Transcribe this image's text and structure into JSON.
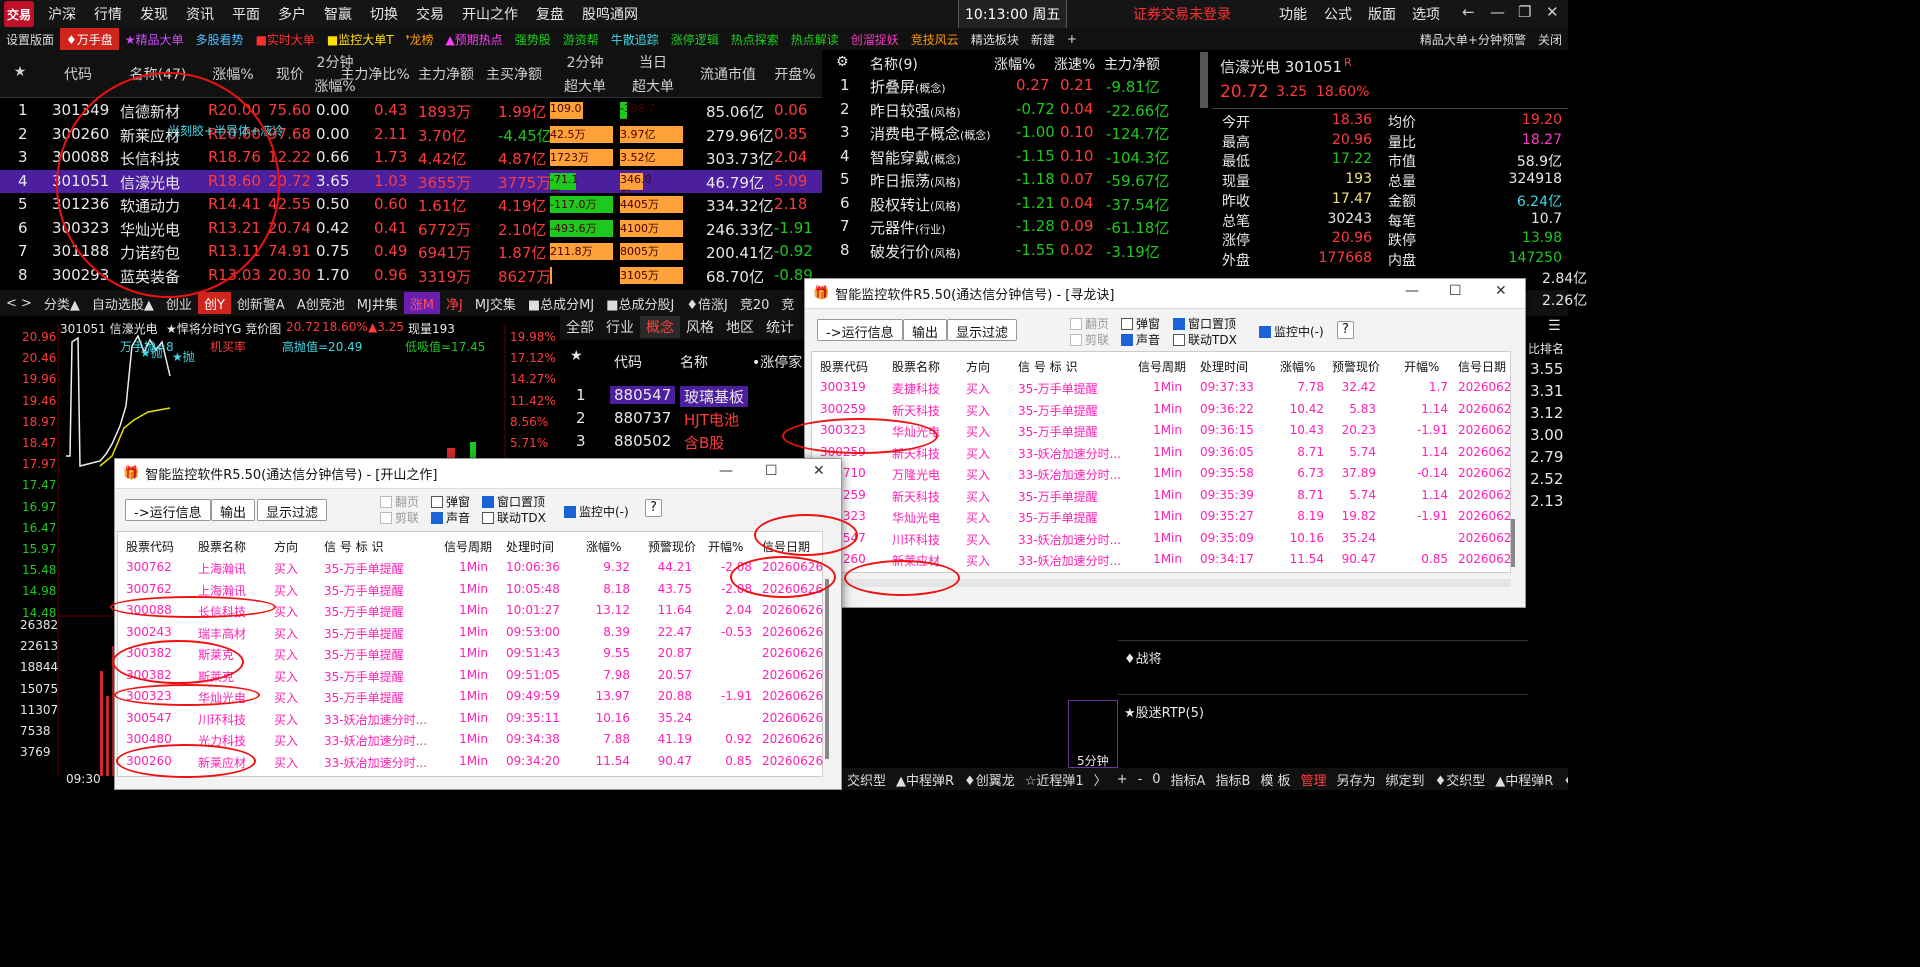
{
  "menu": {
    "logo": "交易",
    "items": [
      "沪深",
      "行情",
      "发现",
      "资讯",
      "平面",
      "多户",
      "智赢",
      "切换",
      "交易",
      "开山之作",
      "复盘",
      "股鸣通网"
    ],
    "time": "10:13:00 周五",
    "warning": "证券交易未登录",
    "right": [
      "功能",
      "公式",
      "版面",
      "选项"
    ],
    "controls": [
      "←",
      "—",
      "❐",
      "✕"
    ]
  },
  "tabs": [
    "设置版面",
    "♦万手盘",
    "★精品大单",
    "多股看势",
    "■实时大单",
    "■监控大单T",
    "❜龙榜",
    "▲预期热点",
    "强势股",
    "游资帮",
    "牛散追踪",
    "涨停逻辑",
    "热点探索",
    "热点解读",
    "创溜捉妖",
    "竞技风云",
    "精选板块",
    "新建",
    "+",
    "精品大单+分钟预警",
    "关闭"
  ],
  "lhead": {
    "star": "★",
    "code": "代码",
    "name": "名称(47)",
    "pct": "涨幅%",
    "price": "现价",
    "min2a": "2分钟",
    "min2b": "涨幅%",
    "zl": "主力净比%",
    "zlj": "主力净额",
    "zm": "主买净额",
    "mm2a": "2分钟",
    "mm2b": "超大单",
    "daya": "当日",
    "dayb": "超大单",
    "mv": "流通市值",
    "open": "开盘%"
  },
  "lrows": [
    {
      "n": "1",
      "code": "301349",
      "name": "信德新材",
      "pct": "20.00",
      "price": "75.60",
      "m2": "0.00",
      "zl": "0.43",
      "zlj": "1893万",
      "zm": "1.99亿",
      "b1": "109.0万",
      "b1v": 0.5,
      "b1c": "o",
      "b2": "-398.7万",
      "b2v": 0.1,
      "b2c": "g",
      "mv": "85.06亿",
      "open": "0.06"
    },
    {
      "n": "2",
      "code": "300260",
      "name": "新莱应材",
      "pct": "20.00",
      "price": "97.68",
      "m2": "0.00",
      "zl": "2.11",
      "zlj": "3.70亿",
      "zm": "-4.45亿",
      "b1": "42.5万",
      "b1v": 0.95,
      "b1c": "o",
      "b2": "3.97亿",
      "b2v": 0.95,
      "b2c": "o",
      "mv": "279.96亿",
      "open": "0.85"
    },
    {
      "n": "3",
      "code": "300088",
      "name": "长信科技",
      "pct": "18.76",
      "price": "12.22",
      "m2": "0.66",
      "zl": "1.73",
      "zlj": "4.42亿",
      "zm": "4.87亿",
      "b1": "1723万",
      "b1v": 0.95,
      "b1c": "o",
      "b2": "3.52亿",
      "b2v": 0.95,
      "b2c": "o",
      "mv": "303.73亿",
      "open": "2.04"
    },
    {
      "n": "4",
      "code": "301051",
      "name": "信濠光电",
      "pct": "18.60",
      "price": "20.72",
      "m2": "3.65",
      "zl": "1.03",
      "zlj": "3655万",
      "zm": "3775万",
      "b1": "-71.1万",
      "b1v": 0.4,
      "b1c": "g",
      "b2": "346.0万",
      "b2v": 0.35,
      "b2c": "o",
      "mv": "46.79亿",
      "open": "5.09"
    },
    {
      "n": "5",
      "code": "301236",
      "name": "软通动力",
      "pct": "14.41",
      "price": "42.55",
      "m2": "0.50",
      "zl": "0.60",
      "zlj": "1.61亿",
      "zm": "4.19亿",
      "b1": "-117.0万",
      "b1v": 0.95,
      "b1c": "g",
      "b2": "4405万",
      "b2v": 0.95,
      "b2c": "o",
      "mv": "334.32亿",
      "open": "2.18"
    },
    {
      "n": "6",
      "code": "300323",
      "name": "华灿光电",
      "pct": "13.21",
      "price": "20.74",
      "m2": "0.42",
      "zl": "0.41",
      "zlj": "6772万",
      "zm": "2.10亿",
      "b1": "-493.6万",
      "b1v": 0.95,
      "b1c": "g",
      "b2": "4100万",
      "b2v": 0.95,
      "b2c": "o",
      "mv": "246.33亿",
      "open": "-1.91"
    },
    {
      "n": "7",
      "code": "301188",
      "name": "力诺药包",
      "pct": "13.11",
      "price": "74.91",
      "m2": "0.75",
      "zl": "0.49",
      "zlj": "6941万",
      "zm": "1.87亿",
      "b1": "211.8万",
      "b1v": 0.95,
      "b1c": "o",
      "b2": "8005万",
      "b2v": 0.95,
      "b2c": "o",
      "mv": "200.41亿",
      "open": "-0.92"
    },
    {
      "n": "8",
      "code": "300293",
      "name": "蓝英装备",
      "pct": "13.03",
      "price": "20.30",
      "m2": "1.70",
      "zl": "0.96",
      "zlj": "3319万",
      "zm": "8627万",
      "b1": "",
      "b1v": 0.03,
      "b1c": "o",
      "b2": "3105万",
      "b2v": 0.95,
      "b2c": "o",
      "mv": "68.70亿",
      "open": "-0.89"
    }
  ],
  "overlay_text": "光刻胶+半导体+液冷",
  "rpanel": {
    "head": [
      "名称(9)",
      "涨幅%",
      "涨速%",
      "主力净额"
    ],
    "rows": [
      {
        "n": "1",
        "name": "折叠屏",
        "tag": "(概念)",
        "pct": "0.27",
        "spd": "0.21",
        "amt": "-9.81亿"
      },
      {
        "n": "2",
        "name": "昨日较强",
        "tag": "(风格)",
        "pct": "-0.72",
        "spd": "0.04",
        "amt": "-22.66亿"
      },
      {
        "n": "3",
        "name": "消费电子概念",
        "tag": "(概念)",
        "pct": "-1.00",
        "spd": "0.10",
        "amt": "-124.7亿"
      },
      {
        "n": "4",
        "name": "智能穿戴",
        "tag": "(概念)",
        "pct": "-1.15",
        "spd": "0.10",
        "amt": "-104.3亿"
      },
      {
        "n": "5",
        "name": "昨日振荡",
        "tag": "(风格)",
        "pct": "-1.18",
        "spd": "0.07",
        "amt": "-59.67亿"
      },
      {
        "n": "6",
        "name": "股权转让",
        "tag": "(风格)",
        "pct": "-1.21",
        "spd": "0.04",
        "amt": "-37.54亿"
      },
      {
        "n": "7",
        "name": "元器件",
        "tag": "(行业)",
        "pct": "-1.28",
        "spd": "0.09",
        "amt": "-61.18亿"
      },
      {
        "n": "8",
        "name": "破发行价",
        "tag": "(风格)",
        "pct": "-1.55",
        "spd": "0.02",
        "amt": "-3.19亿"
      }
    ]
  },
  "quote": {
    "title": "信濠光电 301051",
    "price": "20.72",
    "chg": "3.25",
    "pct": "18.60%",
    "rows": [
      [
        "今开",
        "18.36",
        "均价",
        "19.20"
      ],
      [
        "最高",
        "20.96",
        "量比",
        "18.27"
      ],
      [
        "最低",
        "17.22",
        "市值",
        "58.9亿"
      ],
      [
        "现量",
        "193",
        "总量",
        "324918"
      ],
      [
        "昨收",
        "17.47",
        "金额",
        "6.24亿"
      ],
      [
        "总笔",
        "30243",
        "每笔",
        "10.7"
      ],
      [
        "涨停",
        "20.96",
        "跌停",
        "13.98"
      ],
      [
        "外盘",
        "177668",
        "内盘",
        "147250"
      ]
    ]
  },
  "lowertabs": [
    "< >",
    "分类▲",
    "自动选股▲",
    "创业",
    "创Y",
    "创新警A",
    "A创竞池",
    "MJ井集",
    "涨M",
    "净J",
    "MJ交集",
    "■总成分MJ",
    "■总成分股J",
    "♦倍涨J",
    "竞20",
    "竞"
  ],
  "chart": {
    "head": "301051 信濠光电",
    "head2": "★悍将分时YG 竞价图",
    "price": "20.72",
    "pct": "18.60%",
    "chg": "▲3.25",
    "vol": "现量193",
    "high": "高抛值=20.49",
    "low": "低吸值=17.45",
    "mark1": "万手抛=8",
    "mark2": "★抛",
    "mark3": "★抛",
    "mark4": "机买率",
    "yl": [
      "20.96",
      "20.46",
      "19.96",
      "19.46",
      "18.97",
      "18.47",
      "17.97",
      "17.47",
      "16.97",
      "16.47",
      "15.97",
      "15.48",
      "14.98",
      "14.48"
    ],
    "yr": [
      "19.98%",
      "17.12%",
      "14.27%",
      "11.42%",
      "8.56%",
      "5.71%"
    ],
    "vl": [
      "26382",
      "22613",
      "18844",
      "15075",
      "11307",
      "7538",
      "3769"
    ],
    "time": "09:30"
  },
  "sector": {
    "tabs": [
      "全部",
      "行业",
      "概念",
      "风格",
      "地区",
      "统计"
    ],
    "head": [
      "代码",
      "名称",
      "•涨停家"
    ],
    "rows": [
      [
        "1",
        "880547",
        "玻璃基板"
      ],
      [
        "2",
        "880737",
        "HJT电池"
      ],
      [
        "3",
        "880502",
        "含B股"
      ]
    ]
  },
  "win1": {
    "title": "智能监控软件R5.50(通达信分钟信号) - [开山之作]",
    "btns": [
      "->运行信息",
      "输出",
      "显示过滤"
    ],
    "checks": [
      "翻页",
      "剪联",
      "弹窗",
      "声音",
      "窗口置顶",
      "联动TDX",
      "监控中(-)",
      "?"
    ],
    "cols": [
      "股票代码",
      "股票名称",
      "方向",
      "信 号 标 识",
      "信号周期",
      "处理时间",
      "涨幅%",
      "预警现价",
      "开幅%",
      "信号日期"
    ],
    "rows": [
      [
        "300762",
        "上海瀚讯",
        "买入",
        "35-万手单提醒",
        "1Min",
        "10:06:36",
        "9.32",
        "44.21",
        "-2.08",
        "20260626"
      ],
      [
        "300762",
        "上海瀚讯",
        "买入",
        "35-万手单提醒",
        "1Min",
        "10:05:48",
        "8.18",
        "43.75",
        "-2.08",
        "20260626"
      ],
      [
        "300088",
        "长信科技",
        "买入",
        "35-万手单提醒",
        "1Min",
        "10:01:27",
        "13.12",
        "11.64",
        "2.04",
        "20260626"
      ],
      [
        "300243",
        "瑞丰高材",
        "买入",
        "35-万手单提醒",
        "1Min",
        "09:53:00",
        "8.39",
        "22.47",
        "-0.53",
        "20260626"
      ],
      [
        "300382",
        "斯莱克",
        "买入",
        "35-万手单提醒",
        "1Min",
        "09:51:43",
        "9.55",
        "20.87",
        "",
        "20260626"
      ],
      [
        "300382",
        "斯莱克",
        "买入",
        "35-万手单提醒",
        "1Min",
        "09:51:05",
        "7.98",
        "20.57",
        "",
        "20260626"
      ],
      [
        "300323",
        "华灿光电",
        "买入",
        "35-万手单提醒",
        "1Min",
        "09:49:59",
        "13.97",
        "20.88",
        "-1.91",
        "20260626"
      ],
      [
        "300547",
        "川环科技",
        "买入",
        "33-妖冶加速分时...",
        "1Min",
        "09:35:11",
        "10.16",
        "35.24",
        "",
        "20260626"
      ],
      [
        "300480",
        "光力科技",
        "买入",
        "33-妖冶加速分时...",
        "1Min",
        "09:34:38",
        "7.88",
        "41.19",
        "0.92",
        "20260626"
      ],
      [
        "300260",
        "新莱应材",
        "买入",
        "33-妖冶加速分时...",
        "1Min",
        "09:34:20",
        "11.54",
        "90.47",
        "0.85",
        "20260626"
      ]
    ]
  },
  "win2": {
    "title": "智能监控软件R5.50(通达信分钟信号) - [寻龙诀]",
    "btns": [
      "->运行信息",
      "输出",
      "显示过滤"
    ],
    "checks": [
      "翻页",
      "剪联",
      "弹窗",
      "声音",
      "窗口置顶",
      "联动TDX",
      "监控中(-)",
      "?"
    ],
    "cols": [
      "股票代码",
      "股票名称",
      "方向",
      "信 号 标 识",
      "信号周期",
      "处理时间",
      "涨幅%",
      "预警现价",
      "开幅%",
      "信号日期"
    ],
    "rows": [
      [
        "300319",
        "麦捷科技",
        "买入",
        "35-万手单提醒",
        "1Min",
        "09:37:33",
        "7.78",
        "32.42",
        "1.7",
        "2026062"
      ],
      [
        "300259",
        "新天科技",
        "买入",
        "35-万手单提醒",
        "1Min",
        "09:36:22",
        "10.42",
        "5.83",
        "1.14",
        "2026062"
      ],
      [
        "300323",
        "华灿光电",
        "买入",
        "35-万手单提醒",
        "1Min",
        "09:36:15",
        "10.43",
        "20.23",
        "-1.91",
        "2026062"
      ],
      [
        "300259",
        "新天科技",
        "买入",
        "33-妖冶加速分时...",
        "1Min",
        "09:36:05",
        "8.71",
        "5.74",
        "1.14",
        "2026062"
      ],
      [
        "300710",
        "万隆光电",
        "买入",
        "33-妖冶加速分时...",
        "1Min",
        "09:35:58",
        "6.73",
        "37.89",
        "-0.14",
        "2026062"
      ],
      [
        "300259",
        "新天科技",
        "买入",
        "35-万手单提醒",
        "1Min",
        "09:35:39",
        "8.71",
        "5.74",
        "1.14",
        "2026062"
      ],
      [
        "300323",
        "华灿光电",
        "买入",
        "35-万手单提醒",
        "1Min",
        "09:35:27",
        "8.19",
        "19.82",
        "-1.91",
        "2026062"
      ],
      [
        "300547",
        "川环科技",
        "买入",
        "33-妖冶加速分时...",
        "1Min",
        "09:35:09",
        "10.16",
        "35.24",
        "",
        "2026062"
      ],
      [
        "300260",
        "新莱应材",
        "买入",
        "33-妖冶加速分时...",
        "1Min",
        "09:34:17",
        "11.54",
        "90.47",
        "0.85",
        "2026062"
      ]
    ]
  },
  "rightbottom": {
    "a": "♦战将",
    "b": "★股迷RTP(5)",
    "c": "5分钟",
    "nums": [
      "3.55",
      "3.31",
      "3.12",
      "3.00",
      "2.79",
      "2.52",
      "2.13"
    ],
    "sidelabel": "比排名",
    "ext": [
      "2.84亿",
      "2.26亿"
    ]
  },
  "bottombar": [
    "交织型",
    "▲中程弹R",
    "♦创翼龙",
    "☆近程弹1",
    "〉",
    "+",
    "-",
    "0",
    "指标A",
    "指标B",
    "模 板",
    "管理",
    "另存为",
    "绑定到",
    "♦交织型",
    "▲中程弹R",
    "♦创翼龙",
    "〈"
  ]
}
